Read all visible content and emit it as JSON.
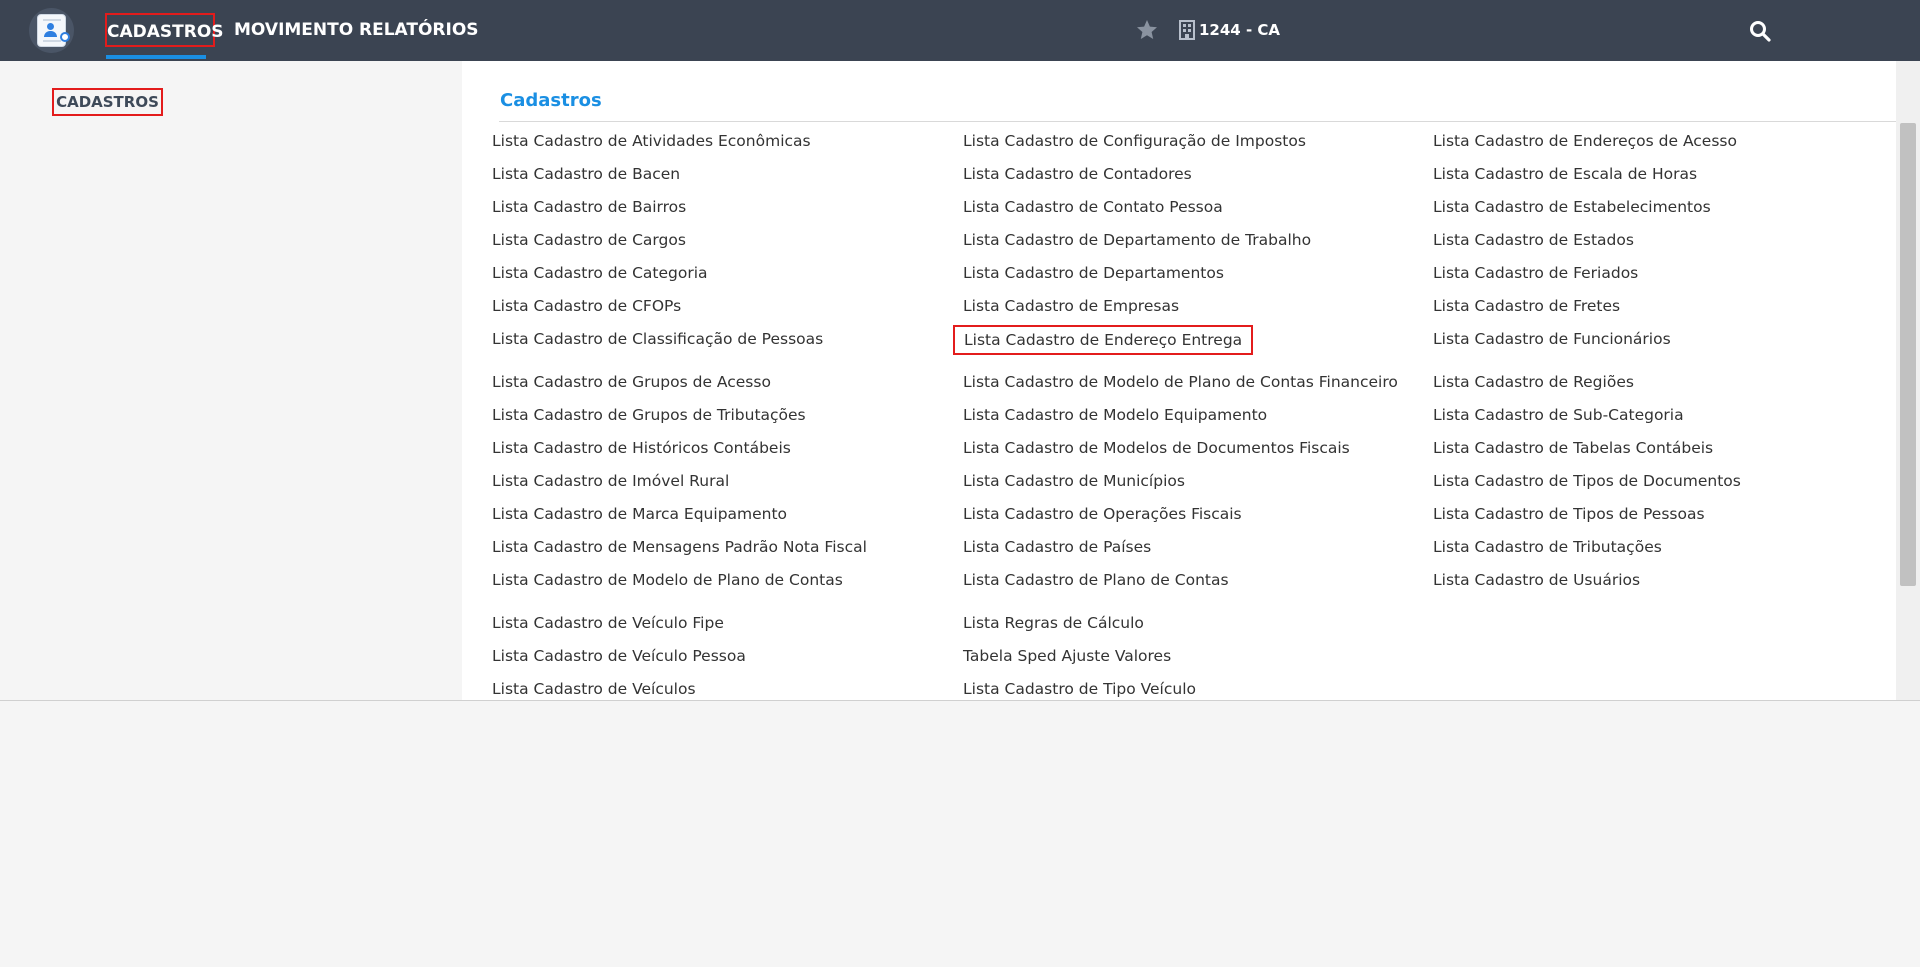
{
  "header": {
    "nav": [
      "CADASTROS",
      "MOVIMENTO",
      "RELATÓRIOS"
    ],
    "branch": "1244 - CA"
  },
  "sidebar": {
    "title": "CADASTROS"
  },
  "main": {
    "title": "Cadastros",
    "columns": [
      [
        "Lista Cadastro de Atividades Econômicas",
        "Lista Cadastro de Bacen",
        "Lista Cadastro de Bairros",
        "Lista Cadastro de Cargos",
        "Lista Cadastro de Categoria",
        "Lista Cadastro de CFOPs",
        "Lista Cadastro de Classificação de Pessoas",
        "Lista Cadastro de Grupos de Acesso",
        "Lista Cadastro de Grupos de Tributações",
        "Lista Cadastro de Históricos Contábeis",
        "Lista Cadastro de Imóvel Rural",
        "Lista Cadastro de Marca Equipamento",
        "Lista Cadastro de Mensagens Padrão Nota Fiscal",
        "Lista Cadastro de Modelo de Plano de Contas",
        "Lista Cadastro de Veículo Fipe",
        "Lista Cadastro de Veículo Pessoa",
        "Lista Cadastro de Veículos"
      ],
      [
        "Lista Cadastro de Configuração de Impostos",
        "Lista Cadastro de Contadores",
        "Lista Cadastro de Contato Pessoa",
        "Lista Cadastro de Departamento de Trabalho",
        "Lista Cadastro de Departamentos",
        "Lista Cadastro de Empresas",
        "Lista Cadastro de Endereço Entrega",
        "Lista Cadastro de Modelo de Plano de Contas Financeiro",
        "Lista Cadastro de Modelo Equipamento",
        "Lista Cadastro de Modelos de Documentos Fiscais",
        "Lista Cadastro de Municípios",
        "Lista Cadastro de Operações Fiscais",
        "Lista Cadastro de Países",
        "Lista Cadastro de Plano de Contas",
        "Lista Regras de Cálculo",
        "Tabela Sped Ajuste Valores",
        "Lista Cadastro de Tipo Veículo"
      ],
      [
        "Lista Cadastro de Endereços de Acesso",
        "Lista Cadastro de Escala de Horas",
        "Lista Cadastro de Estabelecimentos",
        "Lista Cadastro de Estados",
        "Lista Cadastro de Feriados",
        "Lista Cadastro de Fretes",
        "Lista Cadastro de Funcionários",
        "Lista Cadastro de Regiões",
        "Lista Cadastro de Sub-Categoria",
        "Lista Cadastro de Tabelas Contábeis",
        "Lista Cadastro de Tipos de Documentos",
        "Lista Cadastro de Tipos de Pessoas",
        "Lista Cadastro de Tributações",
        "Lista Cadastro de Usuários"
      ]
    ]
  },
  "icons": [
    "app-logo-icon",
    "star-icon",
    "building-icon",
    "search-icon"
  ],
  "colors": {
    "topbar": "#3b4452",
    "accent": "#1a8fe3",
    "highlight": "#e31c1c"
  }
}
